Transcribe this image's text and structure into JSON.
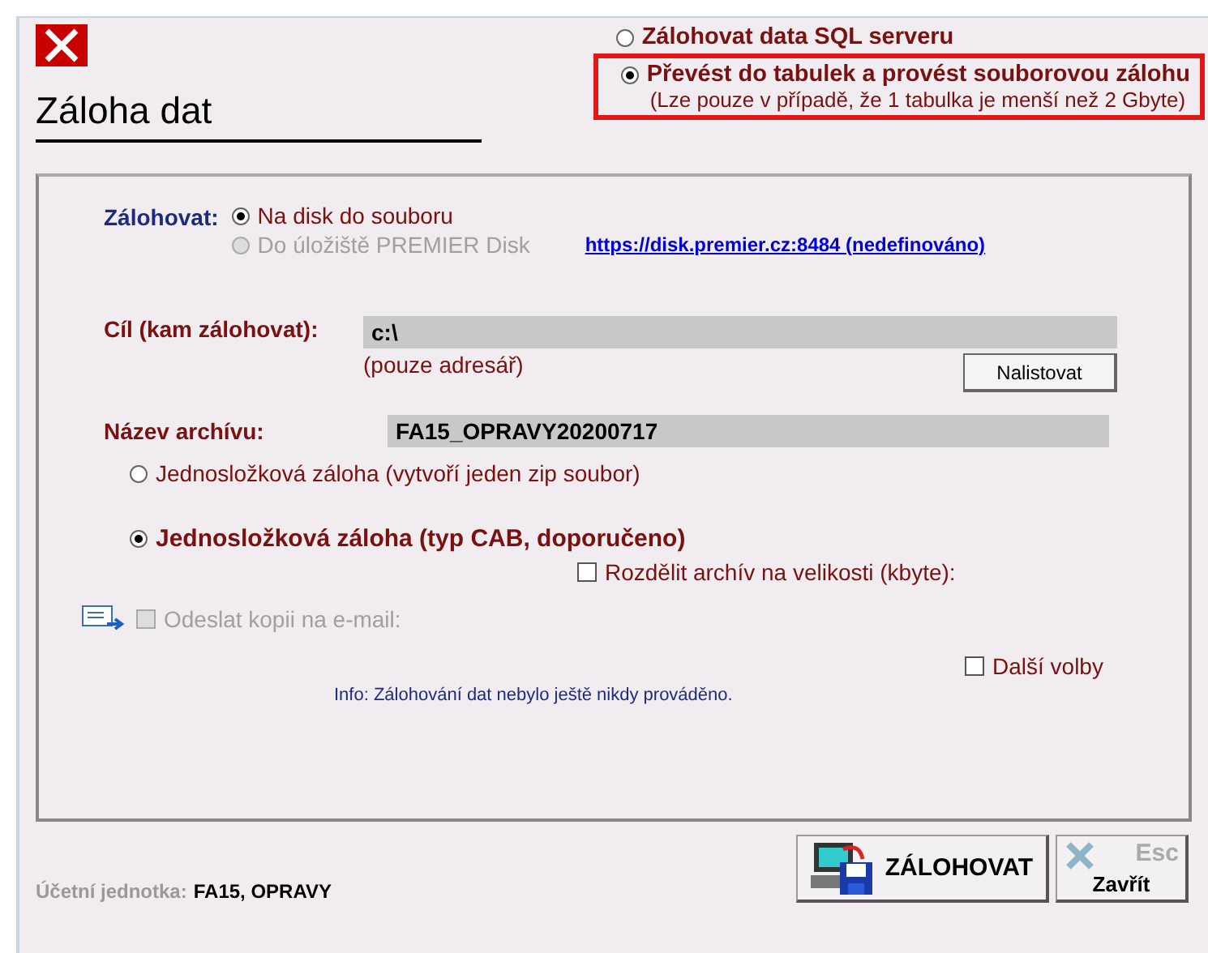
{
  "window": {
    "title": "Záloha dat"
  },
  "mode_options": [
    {
      "label": "Zálohovat data SQL serveru",
      "selected": false,
      "highlighted": false
    },
    {
      "label": "Převést do tabulek a provést souborovou zálohu",
      "selected": true,
      "note": "(Lze pouze v případě, že 1 tabulka je menší než 2 Gbyte)",
      "highlighted": true
    }
  ],
  "target": {
    "label": "Zálohovat:",
    "options": [
      {
        "label": "Na disk do souboru",
        "selected": true,
        "disabled": false
      },
      {
        "label": "Do úložiště PREMIER Disk",
        "selected": false,
        "disabled": true
      }
    ],
    "link": "https://disk.premier.cz:8484 (nedefinováno)"
  },
  "destination": {
    "label": "Cíl (kam zálohovat):",
    "value": "c:\\",
    "hint": "(pouze adresář)",
    "button": "Nalistovat"
  },
  "archive": {
    "label": "Název archívu:",
    "value": "FA15_OPRAVY20200717"
  },
  "archive_types": [
    {
      "label": "Jednosložková záloha (vytvoří jeden zip soubor)",
      "selected": false
    },
    {
      "label": "Jednosložková záloha (typ CAB, doporučeno)",
      "selected": true
    }
  ],
  "split": {
    "label": "Rozdělit archív na velikosti (kbyte):",
    "checked": false
  },
  "email": {
    "label": "Odeslat kopii na e-mail:",
    "checked": false,
    "disabled": true
  },
  "more_options": {
    "label": "Další volby",
    "checked": false
  },
  "info": "Info: Zálohování dat nebylo ještě nikdy prováděno.",
  "status": {
    "label": "Účetní jednotka:",
    "value": "FA15, OPRAVY"
  },
  "buttons": {
    "backup": "ZÁLOHOVAT",
    "close_key": "Esc",
    "close": "Zavřít"
  }
}
